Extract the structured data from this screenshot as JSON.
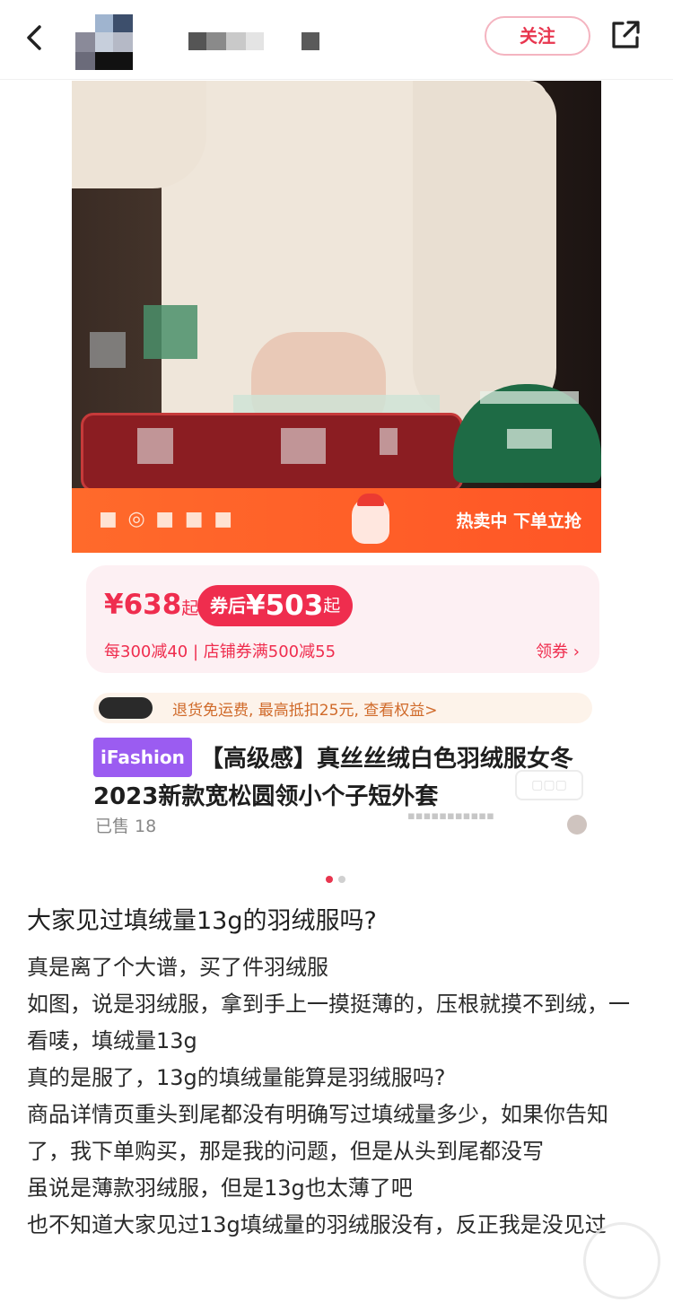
{
  "header": {
    "follow_label": "关注"
  },
  "product": {
    "live_banner_right": "热卖中 下单立抢",
    "price_original": "¥638",
    "price_original_suffix": "起",
    "coupon_label": "券后",
    "coupon_price": "¥503",
    "coupon_suffix": "起",
    "promo_text": "每300减40 | 店铺券满500减55",
    "get_coupon_label": "领券 ›",
    "return_text": "退货免运费, 最高抵扣25元, 查看权益>",
    "tag": "iFashion",
    "title": "【高级感】真丝丝绒白色羽绒服女冬2023新款宽松圆领小个子短外套",
    "sold": "已售 18"
  },
  "carousel": {
    "active_color": "#e8364f",
    "inactive_color": "#d0d0d0"
  },
  "post": {
    "title": "大家见过填绒量13g的羽绒服吗?",
    "lines": [
      "真是离了个大谱，买了件羽绒服",
      "如图，说是羽绒服，拿到手上一摸挺薄的，压根就摸不到绒，一看唛，填绒量13g",
      "真的是服了，13g的填绒量能算是羽绒服吗?",
      "商品详情页重头到尾都没有明确写过填绒量多少，如果你告知了，我下单购买，那是我的问题，但是从头到尾都没写",
      "虽说是薄款羽绒服，但是13g也太薄了吧",
      "也不知道大家见过13g填绒量的羽绒服没有，反正我是没见过"
    ]
  },
  "colors": {
    "accent": "#e8364f",
    "price": "#ef2d4e",
    "tag": "#9b5cf1"
  }
}
